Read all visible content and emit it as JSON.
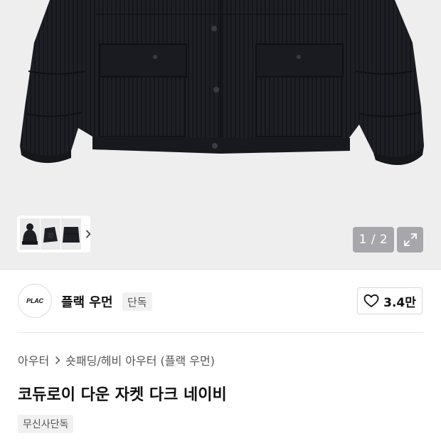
{
  "gallery": {
    "counter": "1 / 2",
    "thumbnails": [
      "beanie",
      "jacket-side",
      "jacket-back"
    ]
  },
  "icons": {
    "thumb_chevron": "chevron-right-icon",
    "expand": "expand-icon",
    "like": "heart-icon",
    "breadcrumb_separator": "chevron-right-icon"
  },
  "brand": {
    "logo_text": "PLAC",
    "name": "플랙 우먼",
    "badge": "단독"
  },
  "like": {
    "count": "3.4만"
  },
  "breadcrumb": {
    "category": "아우터",
    "subcategory": "숏패딩/헤비 아우터 (플랙 우먼)"
  },
  "product": {
    "title": "코듀로이 다운 자켓 다크 네이비",
    "tag": "무신사단독"
  },
  "colors": {
    "hero_bg": "#eeeeef",
    "jacket": "#1c1d22",
    "overlay_button": "#8a8a8f"
  }
}
